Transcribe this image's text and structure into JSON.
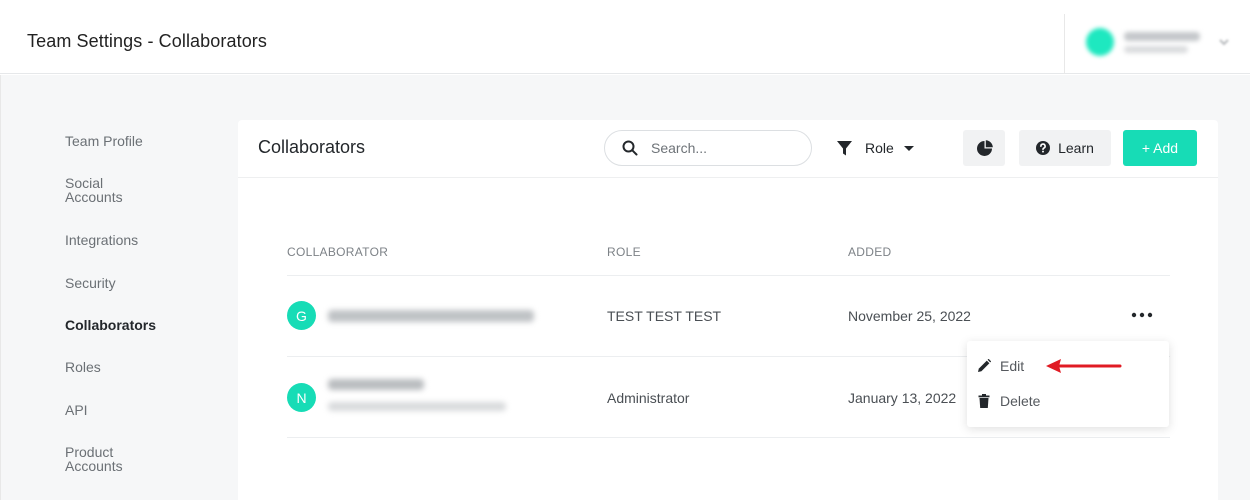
{
  "header": {
    "title": "Team Settings - Collaborators"
  },
  "sidebar": {
    "items": [
      {
        "label": "Team Profile"
      },
      {
        "label": "Social\nAccounts"
      },
      {
        "label": "Integrations"
      },
      {
        "label": "Security"
      },
      {
        "label": "Collaborators",
        "active": true
      },
      {
        "label": "Roles"
      },
      {
        "label": "API"
      },
      {
        "label": "Product\nAccounts"
      }
    ]
  },
  "card": {
    "title": "Collaborators",
    "search": {
      "placeholder": "Search...",
      "value": ""
    },
    "role_filter_label": "Role",
    "learn_label": "Learn",
    "add_label": "+ Add"
  },
  "table": {
    "columns": [
      "COLLABORATOR",
      "ROLE",
      "ADDED"
    ],
    "rows": [
      {
        "initial": "G",
        "role": "TEST TEST TEST",
        "added": "November 25, 2022"
      },
      {
        "initial": "N",
        "role": "Administrator",
        "added": "January 13, 2022"
      }
    ]
  },
  "row_menu": {
    "edit_label": "Edit",
    "delete_label": "Delete"
  },
  "colors": {
    "accent": "#17dcb6",
    "annotation_arrow": "#e01b24"
  },
  "icons": [
    "search-icon",
    "filter-icon",
    "caret-down-icon",
    "pie-chart-icon",
    "question-circle-icon",
    "more-horizontal-icon",
    "pencil-icon",
    "trash-icon"
  ]
}
